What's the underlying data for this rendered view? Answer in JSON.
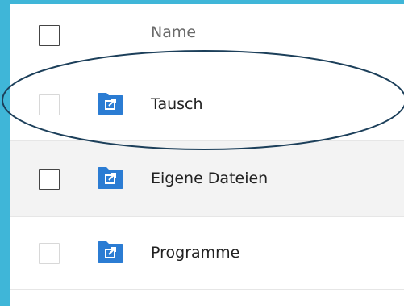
{
  "list": {
    "header": {
      "name_label": "Name"
    },
    "rows": [
      {
        "name": "Tausch",
        "icon": "shared-folder-icon"
      },
      {
        "name": "Eigene Dateien",
        "icon": "shared-folder-icon"
      },
      {
        "name": "Programme",
        "icon": "shared-folder-icon"
      }
    ]
  },
  "colors": {
    "frame": "#3fb6d8",
    "folder": "#2b7cd3",
    "annotation": "#1c3f5a"
  }
}
